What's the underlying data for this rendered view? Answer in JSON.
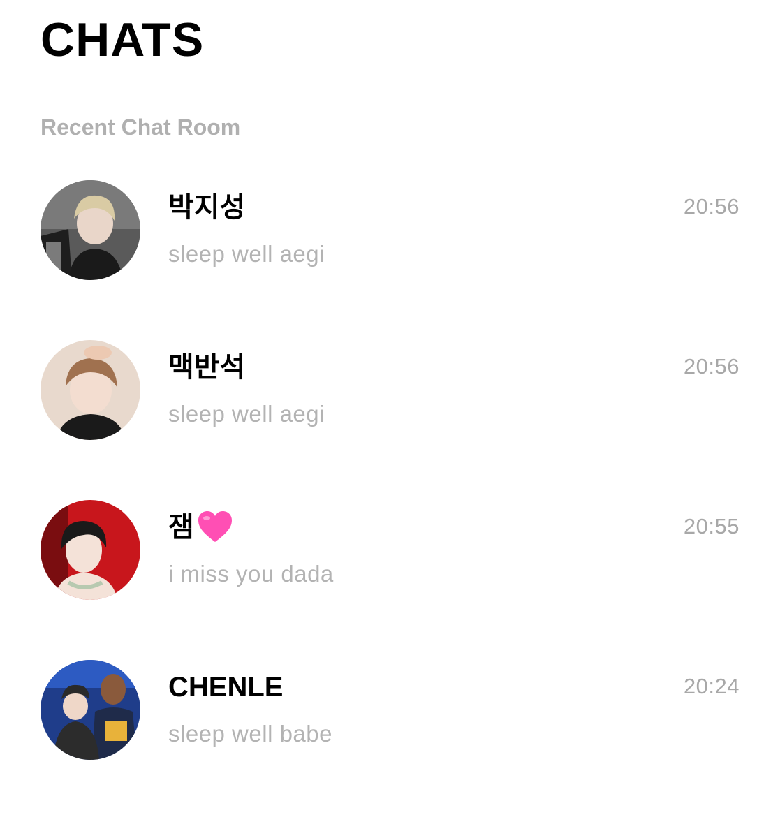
{
  "header": {
    "title": "CHATS",
    "section_label": "Recent Chat Room"
  },
  "chats": [
    {
      "name": "박지성",
      "preview": "sleep well aegi",
      "time": "20:56",
      "avatar": "avatar-photo-grey-background"
    },
    {
      "name": "맥반석",
      "preview": "sleep well aegi",
      "time": "20:56",
      "avatar": "avatar-photo-beige-background"
    },
    {
      "name": "잼",
      "name_emoji": "pink-heart-icon",
      "preview": "i miss you dada",
      "time": "20:55",
      "avatar": "avatar-photo-red-background"
    },
    {
      "name": "CHENLE",
      "preview": "sleep well babe",
      "time": "20:24",
      "avatar": "avatar-photo-group-blue-background"
    }
  ],
  "colors": {
    "background": "#ffffff",
    "title": "#000000",
    "section_label": "#b0b0b0",
    "preview_text": "#b3b3b3",
    "time_text": "#a8a8a8",
    "heart": "#ff4fb4"
  }
}
